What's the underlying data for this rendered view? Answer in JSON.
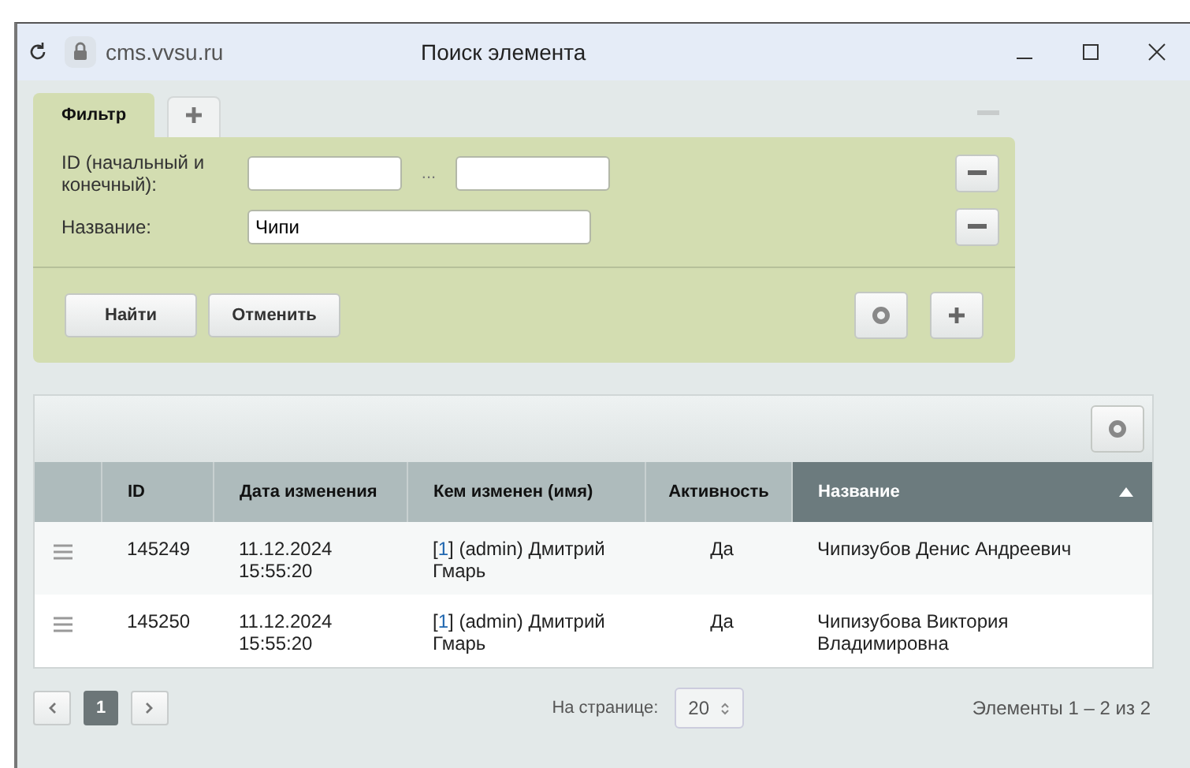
{
  "window": {
    "address": "cms.vvsu.ru",
    "title": "Поиск элемента"
  },
  "filter": {
    "tabs": [
      {
        "label": "Фильтр",
        "selected": true
      }
    ],
    "fields": [
      {
        "label": "ID (начальный и конечный):",
        "kind": "range",
        "separator": "..."
      },
      {
        "label": "Название:",
        "kind": "text",
        "value": "Чипи"
      }
    ],
    "buttons": [
      "Найти",
      "Отменить"
    ]
  },
  "table": {
    "columns": [
      {
        "label": "ID",
        "selected": false
      },
      {
        "label": "Дата изменения",
        "selected": false
      },
      {
        "label": "Кем изменен (имя)",
        "selected": false
      },
      {
        "label": "Активность",
        "selected": false
      },
      {
        "label": "Название",
        "selected": true
      }
    ],
    "rows": [
      {
        "id": "145249",
        "date": "11.12.2024 15:55:20",
        "by_before": "[",
        "by_link": "1",
        "by_after": "] (admin) Дмитрий Гмарь",
        "active": "Да",
        "name": "Чипизубов Денис Андреевич"
      },
      {
        "id": "145250",
        "date": "11.12.2024 15:55:20",
        "by_before": "[",
        "by_link": "1",
        "by_after": "] (admin) Дмитрий Гмарь",
        "active": "Да",
        "name": "Чипизубова Виктория Владимировна"
      }
    ]
  },
  "pager": {
    "pages": [
      {
        "label": "1",
        "selected": true
      }
    ],
    "per_page_label": "На странице:",
    "per_page": "20",
    "summary": "Элементы 1 – 2 из 2"
  }
}
